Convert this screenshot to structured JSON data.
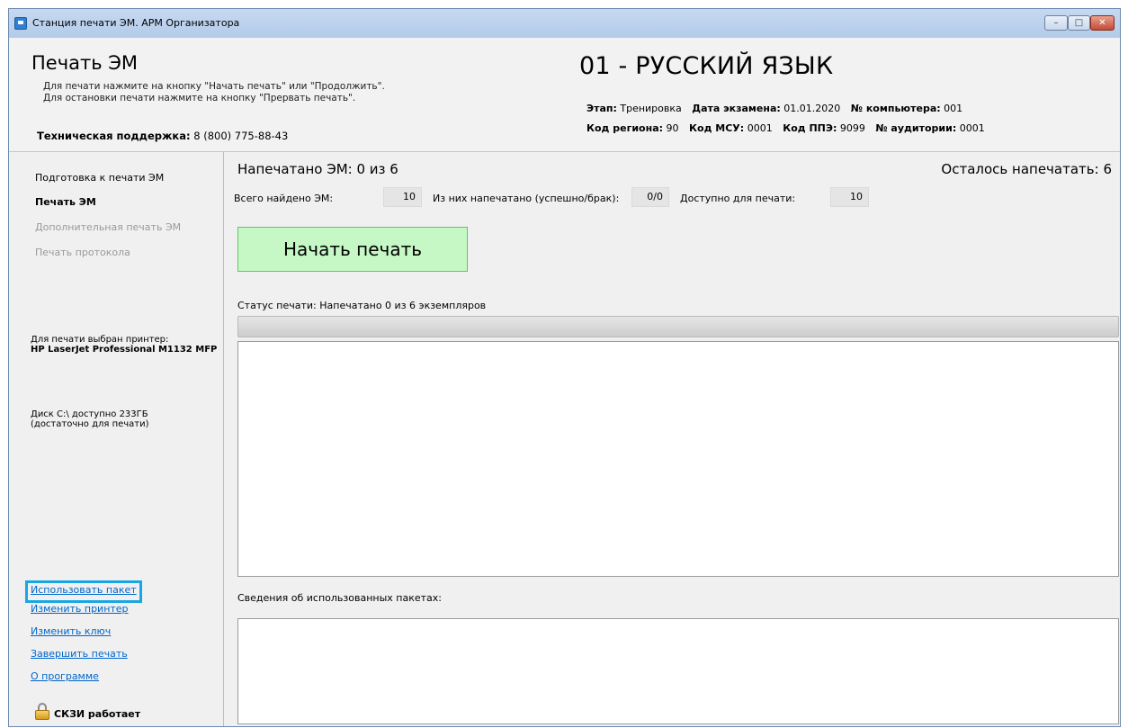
{
  "window": {
    "title": "Станция печати ЭМ. АРМ Организатора",
    "controls": {
      "minimize": "–",
      "maximize": "□",
      "close": "✕"
    }
  },
  "header": {
    "title": "Печать ЭМ",
    "hint_line1": "Для печати нажмите на кнопку \"Начать печать\" или \"Продолжить\".",
    "hint_line2": "Для остановки печати нажмите на кнопку \"Прервать печать\".",
    "support_label": "Техническая поддержка:",
    "support_phone": "8 (800) 775-88-43",
    "subject": "01 - РУССКИЙ ЯЗЫК",
    "stage_label": "Этап:",
    "stage_value": "Тренировка",
    "exam_date_label": "Дата экзамена:",
    "exam_date_value": "01.01.2020",
    "computer_label": "№ компьютера:",
    "computer_value": "001",
    "region_label": "Код региона:",
    "region_value": "90",
    "msu_label": "Код МСУ:",
    "msu_value": "0001",
    "ppe_label": "Код ППЭ:",
    "ppe_value": "9099",
    "auditorium_label": "№ аудитории:",
    "auditorium_value": "0001"
  },
  "sidebar": {
    "nav": [
      {
        "label": "Подготовка к печати ЭМ",
        "state": "normal"
      },
      {
        "label": "Печать ЭМ",
        "state": "active"
      },
      {
        "label": "Дополнительная печать ЭМ",
        "state": "disabled"
      },
      {
        "label": "Печать протокола",
        "state": "disabled"
      }
    ],
    "printer_caption": "Для печати выбран принтер:",
    "printer_name": "HP LaserJet Professional M1132 MFP",
    "disk_line1": "Диск C:\\ доступно 233ГБ",
    "disk_line2": "(достаточно для печати)",
    "links": [
      "Использовать пакет",
      "Изменить принтер",
      "Изменить ключ",
      "Завершить печать",
      "О программе"
    ],
    "crypto_status": "СКЗИ работает",
    "crypto_icon": "lock-icon"
  },
  "main": {
    "printed_text": "Напечатано ЭМ:  0  из  6",
    "remaining_text": "Осталось напечатать:  6",
    "found_label": "Всего найдено ЭМ:",
    "found_value": "10",
    "printed_label": "Из них напечатано (успешно/брак):",
    "printed_value": "0/0",
    "available_label": "Доступно для печати:",
    "available_value": "10",
    "start_button": "Начать печать",
    "status_label": "Статус печати:",
    "status_value": "Напечатано 0 из 6 экземпляров",
    "progress": 0,
    "packets_label": "Сведения об использованных пакетах:"
  },
  "colors": {
    "start_button_bg": "#c6f8c6",
    "link": "#0066cc",
    "highlight_box": "#1aa6e4"
  }
}
